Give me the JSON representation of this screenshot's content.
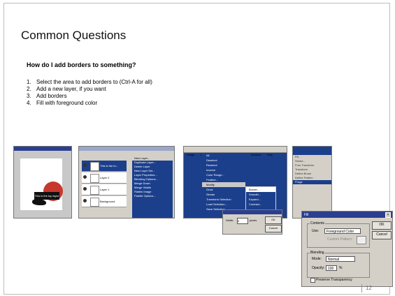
{
  "slide": {
    "title": "Common Questions",
    "question": "How do I add borders to something?",
    "steps": [
      {
        "num": "1.",
        "text": "Select the area to add borders to (Ctrl-A for all)"
      },
      {
        "num": "2.",
        "text": "Add a new layer, if you want"
      },
      {
        "num": "3.",
        "text": "Add borders"
      },
      {
        "num": "4.",
        "text": "Fill with foreground color"
      }
    ],
    "page_number": "12"
  },
  "shot1": {
    "caption_text": "This is the top layer"
  },
  "shot2": {
    "layers": [
      "This is the to...",
      "Layer 2",
      "Layer 1",
      "Background"
    ],
    "menu": [
      "New Layer...",
      "Duplicate Layer...",
      "Delete Layer",
      "New Layer Set...",
      "Layer Properties...",
      "Blending Options...",
      "Merge Down",
      "Merge Visible",
      "Flatten Image",
      "Palette Options..."
    ]
  },
  "shot3": {
    "menubar": [
      "Image",
      "Layer",
      "Select",
      "Filter",
      "View",
      "Window",
      "Help"
    ],
    "menu": [
      "All",
      "Deselect",
      "Reselect",
      "Inverse",
      "Color Range...",
      "Feather...",
      "Modify",
      "Grow",
      "Similar",
      "Transform Selection",
      "Load Selection...",
      "Save Selection..."
    ],
    "submenu": [
      "Border...",
      "Smooth...",
      "Expand...",
      "Contract..."
    ],
    "border_dialog": {
      "width_label": "Width:",
      "width_value": "3",
      "unit": "pixels",
      "ok": "OK",
      "cancel": "Cancel"
    }
  },
  "shot4": {
    "items": [
      "Fill...",
      "Stroke...",
      "Free Transform",
      "Transform",
      "Define Brush",
      "Define Pattern",
      "Purge"
    ]
  },
  "fill_dialog": {
    "title": "Fill",
    "contents_label": "Contents",
    "use_label": "Use:",
    "use_value": "Foreground Color",
    "pattern_label": "Custom Pattern:",
    "blending_label": "Blending",
    "mode_label": "Mode:",
    "mode_value": "Normal",
    "opacity_label": "Opacity:",
    "opacity_value": "100",
    "percent": "%",
    "preserve_label": "Preserve Transparency",
    "ok": "OK",
    "cancel": "Cancel"
  }
}
